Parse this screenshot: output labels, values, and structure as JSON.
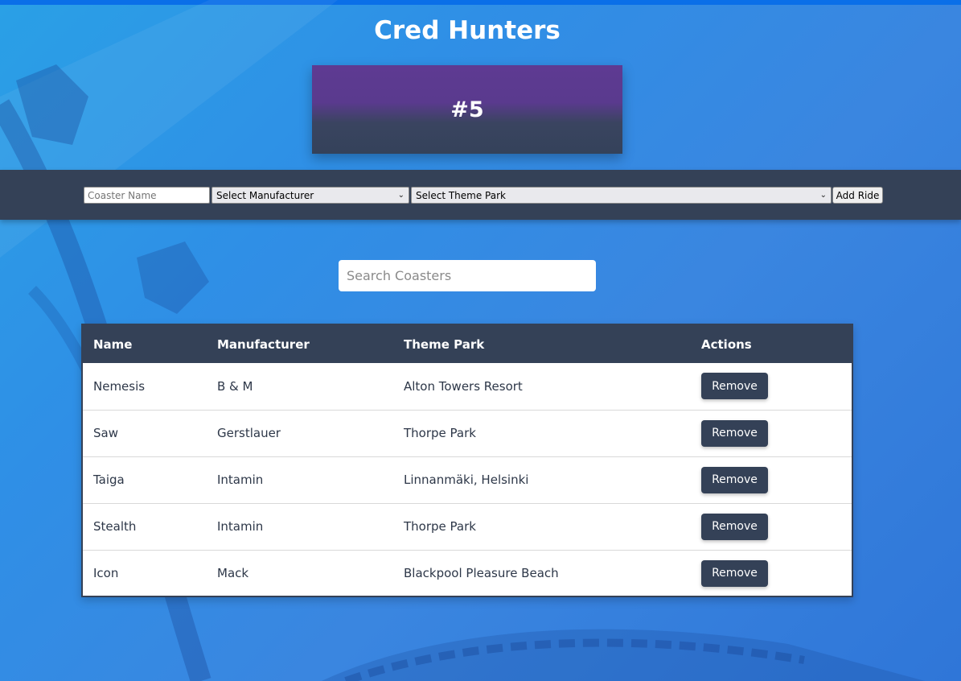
{
  "app": {
    "title": "Cred Hunters",
    "rank": "#5"
  },
  "form": {
    "name_placeholder": "Coaster Name",
    "manufacturer_select": "Select Manufacturer",
    "park_select": "Select Theme Park",
    "add_button": "Add Ride"
  },
  "search": {
    "placeholder": "Search Coasters"
  },
  "table": {
    "headers": [
      "Name",
      "Manufacturer",
      "Theme Park",
      "Actions"
    ],
    "rows": [
      {
        "name": "Nemesis",
        "manufacturer": "B & M",
        "park": "Alton Towers Resort",
        "action": "Remove"
      },
      {
        "name": "Saw",
        "manufacturer": "Gerstlauer",
        "park": "Thorpe Park",
        "action": "Remove"
      },
      {
        "name": "Taiga",
        "manufacturer": "Intamin",
        "park": "Linnanmäki, Helsinki",
        "action": "Remove"
      },
      {
        "name": "Stealth",
        "manufacturer": "Intamin",
        "park": "Thorpe Park",
        "action": "Remove"
      },
      {
        "name": "Icon",
        "manufacturer": "Mack",
        "park": "Blackpool Pleasure Beach",
        "action": "Remove"
      }
    ]
  },
  "colors": {
    "accent": "#344157",
    "rank_top": "#5e3a92",
    "background": "#2f8fe6"
  }
}
